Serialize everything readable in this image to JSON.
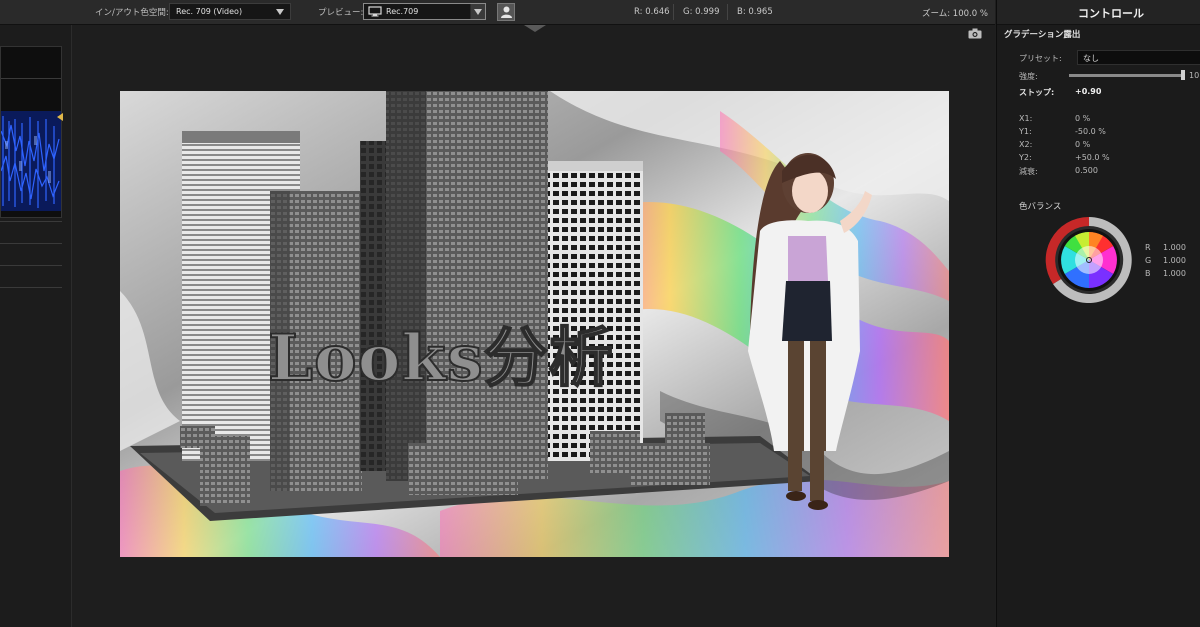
{
  "toolbar": {
    "colorspace_label": "イン/アウト色空間:",
    "colorspace_value": "Rec. 709 (Video)",
    "preview_label": "プレビュー:",
    "preview_value": "Rec.709",
    "r": "R: 0.646",
    "g": "G: 0.999",
    "b": "B: 0.965",
    "zoom": "ズーム: 100.0 %"
  },
  "viewer": {
    "title_text": "Looks分析"
  },
  "controls": {
    "header": "コントロール",
    "section": "グラデーション露出",
    "preset_label": "プリセット:",
    "preset_value": "なし",
    "strength_label": "強度:",
    "strength_value": "10",
    "strength_level": 1.0,
    "stop_label": "ストップ:",
    "stop_value": "+0.90",
    "params": [
      {
        "label": "X1:",
        "value": "0 %"
      },
      {
        "label": "Y1:",
        "value": "-50.0 %"
      },
      {
        "label": "X2:",
        "value": "0 %"
      },
      {
        "label": "Y2:",
        "value": "+50.0 %"
      },
      {
        "label": "減衰:",
        "value": "0.500"
      }
    ],
    "color_balance_label": "色バランス",
    "balance": [
      {
        "label": "R",
        "value": "1.000"
      },
      {
        "label": "G",
        "value": "1.000"
      },
      {
        "label": "B",
        "value": "1.000"
      }
    ]
  },
  "icons": {
    "monitor": "monitor-icon",
    "person": "person-icon",
    "camera": "camera-icon",
    "collapse": "triangle-down-icon"
  }
}
